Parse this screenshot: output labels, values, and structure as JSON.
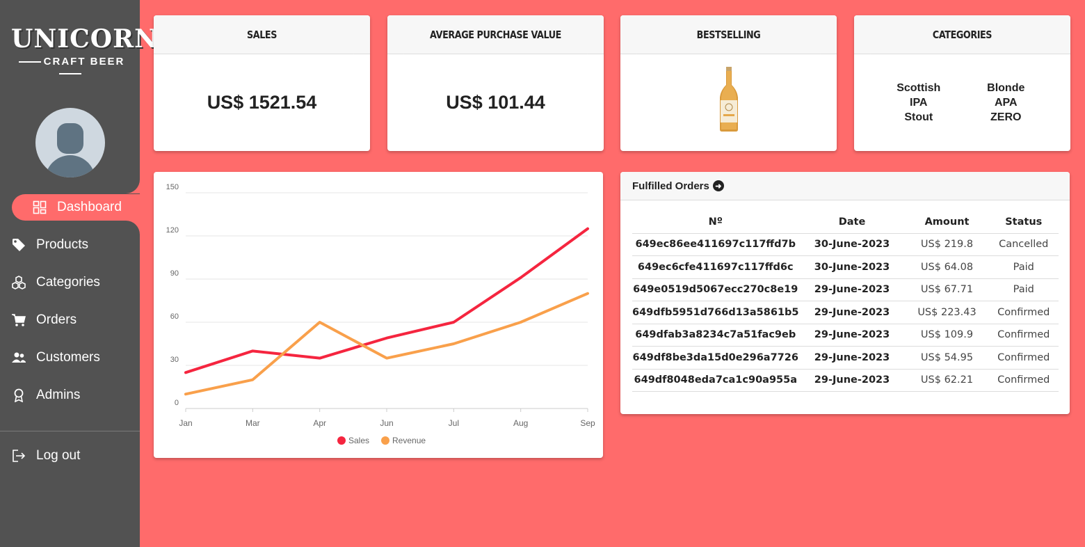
{
  "brand": {
    "name": "UNICORN",
    "tagline": "CRAFT BEER"
  },
  "nav": {
    "dashboard": "Dashboard",
    "products": "Products",
    "categories": "Categories",
    "orders": "Orders",
    "customers": "Customers",
    "admins": "Admins",
    "logout": "Log out"
  },
  "cards": {
    "sales": {
      "title": "SALES",
      "value": "US$ 1521.54"
    },
    "avg": {
      "title": "AVERAGE PURCHASE VALUE",
      "value": "US$ 101.44"
    },
    "bestselling": {
      "title": "BESTSELLING"
    },
    "categories": {
      "title": "CATEGORIES",
      "items": [
        "Scottish",
        "Blonde",
        "IPA",
        "APA",
        "Stout",
        "ZERO"
      ]
    }
  },
  "orders": {
    "title": "Fulfilled Orders",
    "columns": [
      "Nº",
      "Date",
      "Amount",
      "Status"
    ],
    "rows": [
      [
        "649ec86ee411697c117ffd7b",
        "30-June-2023",
        "US$ 219.8",
        "Cancelled"
      ],
      [
        "649ec6cfe411697c117ffd6c",
        "30-June-2023",
        "US$ 64.08",
        "Paid"
      ],
      [
        "649e0519d5067ecc270c8e19",
        "29-June-2023",
        "US$ 67.71",
        "Paid"
      ],
      [
        "649dfb5951d766d13a5861b5",
        "29-June-2023",
        "US$ 223.43",
        "Confirmed"
      ],
      [
        "649dfab3a8234c7a51fac9eb",
        "29-June-2023",
        "US$ 109.9",
        "Confirmed"
      ],
      [
        "649df8be3da15d0e296a7726",
        "29-June-2023",
        "US$ 54.95",
        "Confirmed"
      ],
      [
        "649df8048eda7ca1c90a955a",
        "29-June-2023",
        "US$ 62.21",
        "Confirmed"
      ]
    ]
  },
  "colors": {
    "accent": "#ff6b6b",
    "sidebar": "#525252",
    "sales": "#f5253f",
    "revenue": "#f9a04b"
  },
  "chart_data": {
    "type": "line",
    "categories": [
      "Jan",
      "Mar",
      "Apr",
      "Jun",
      "Jul",
      "Aug",
      "Sep"
    ],
    "series": [
      {
        "name": "Sales",
        "color": "#f5253f",
        "values": [
          25,
          40,
          35,
          49,
          60,
          91,
          125
        ]
      },
      {
        "name": "Revenue",
        "color": "#f9a04b",
        "values": [
          10,
          20,
          60,
          35,
          45,
          60,
          80
        ]
      }
    ],
    "yticks": [
      0,
      30,
      60,
      90,
      120,
      150
    ],
    "ylim": [
      0,
      150
    ],
    "grid": true,
    "legend": "bottom"
  }
}
